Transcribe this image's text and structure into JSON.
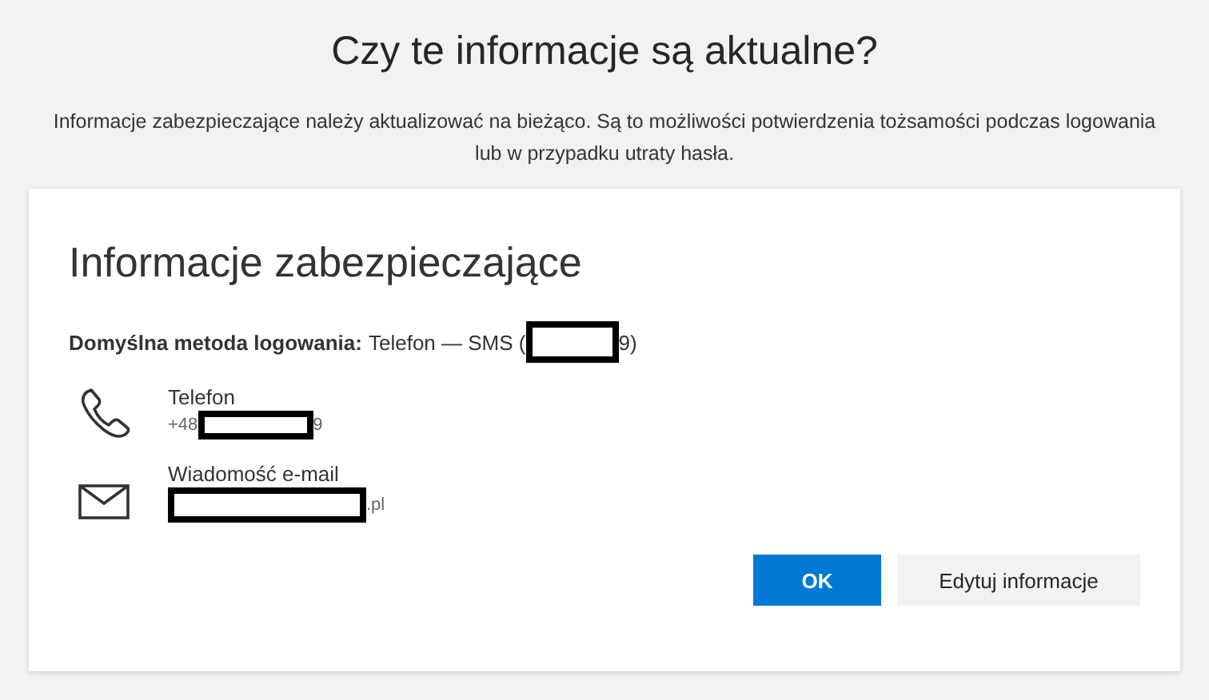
{
  "title": "Czy te informacje są aktualne?",
  "description": "Informacje zabezpieczające należy aktualizować na bieżąco. Są to możliwości potwierdzenia tożsamości podczas logowania lub w przypadku utraty hasła.",
  "card": {
    "heading": "Informacje zabezpieczające",
    "default_method": {
      "label": "Domyślna metoda logowania:",
      "value_before": "Telefon — SMS (",
      "value_after": "9)"
    },
    "methods": [
      {
        "kind": "phone",
        "name": "Telefon",
        "detail_before": "+48",
        "detail_after": "9"
      },
      {
        "kind": "email",
        "name": "Wiadomość e-mail",
        "detail_after": ".pl"
      }
    ],
    "buttons": [
      {
        "label": "OK",
        "kind": "primary"
      },
      {
        "label": "Edytuj informacje",
        "kind": "secondary"
      }
    ]
  }
}
